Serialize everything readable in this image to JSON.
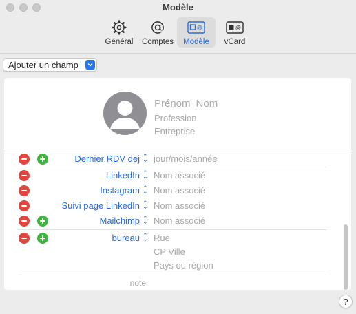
{
  "window": {
    "title": "Modèle"
  },
  "toolbar": {
    "items": [
      {
        "label": "Général",
        "icon": "gear-icon"
      },
      {
        "label": "Comptes",
        "icon": "at-sign-icon"
      },
      {
        "label": "Modèle",
        "icon": "template-card-icon",
        "active": true
      },
      {
        "label": "vCard",
        "icon": "vcard-icon"
      }
    ]
  },
  "add_field": {
    "label": "Ajouter un champ"
  },
  "card": {
    "first_name_placeholder": "Prénom",
    "last_name_placeholder": "Nom",
    "profession_placeholder": "Profession",
    "company_placeholder": "Entreprise",
    "fields": [
      {
        "label": "Dernier RDV dej",
        "value": "jour/mois/année",
        "minus": true,
        "plus": true
      },
      {
        "label": "LinkedIn",
        "value": "Nom associé",
        "minus": true,
        "plus": false
      },
      {
        "label": "Instagram",
        "value": "Nom associé",
        "minus": true,
        "plus": false
      },
      {
        "label": "Suivi page LinkedIn",
        "value": "Nom associé",
        "minus": true,
        "plus": false
      },
      {
        "label": "Mailchimp",
        "value": "Nom associé",
        "minus": true,
        "plus": true
      }
    ],
    "address": {
      "label": "bureau",
      "street": "Rue",
      "city": "CP Ville",
      "country": "Pays ou région"
    },
    "note_placeholder": "note"
  },
  "help": {
    "label": "?"
  },
  "colors": {
    "accent": "#2b6cd9",
    "minus": "#e0463d",
    "plus": "#3fb53f"
  }
}
